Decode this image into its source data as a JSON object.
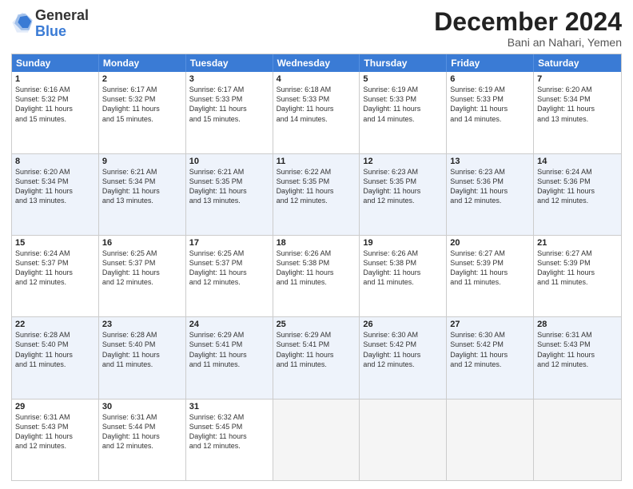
{
  "logo": {
    "general": "General",
    "blue": "Blue"
  },
  "title": "December 2024",
  "location": "Bani an Nahari, Yemen",
  "days": [
    "Sunday",
    "Monday",
    "Tuesday",
    "Wednesday",
    "Thursday",
    "Friday",
    "Saturday"
  ],
  "weeks": [
    [
      {
        "day": "1",
        "lines": [
          "Sunrise: 6:16 AM",
          "Sunset: 5:32 PM",
          "Daylight: 11 hours",
          "and 15 minutes."
        ]
      },
      {
        "day": "2",
        "lines": [
          "Sunrise: 6:17 AM",
          "Sunset: 5:32 PM",
          "Daylight: 11 hours",
          "and 15 minutes."
        ]
      },
      {
        "day": "3",
        "lines": [
          "Sunrise: 6:17 AM",
          "Sunset: 5:33 PM",
          "Daylight: 11 hours",
          "and 15 minutes."
        ]
      },
      {
        "day": "4",
        "lines": [
          "Sunrise: 6:18 AM",
          "Sunset: 5:33 PM",
          "Daylight: 11 hours",
          "and 14 minutes."
        ]
      },
      {
        "day": "5",
        "lines": [
          "Sunrise: 6:19 AM",
          "Sunset: 5:33 PM",
          "Daylight: 11 hours",
          "and 14 minutes."
        ]
      },
      {
        "day": "6",
        "lines": [
          "Sunrise: 6:19 AM",
          "Sunset: 5:33 PM",
          "Daylight: 11 hours",
          "and 14 minutes."
        ]
      },
      {
        "day": "7",
        "lines": [
          "Sunrise: 6:20 AM",
          "Sunset: 5:34 PM",
          "Daylight: 11 hours",
          "and 13 minutes."
        ]
      }
    ],
    [
      {
        "day": "8",
        "lines": [
          "Sunrise: 6:20 AM",
          "Sunset: 5:34 PM",
          "Daylight: 11 hours",
          "and 13 minutes."
        ]
      },
      {
        "day": "9",
        "lines": [
          "Sunrise: 6:21 AM",
          "Sunset: 5:34 PM",
          "Daylight: 11 hours",
          "and 13 minutes."
        ]
      },
      {
        "day": "10",
        "lines": [
          "Sunrise: 6:21 AM",
          "Sunset: 5:35 PM",
          "Daylight: 11 hours",
          "and 13 minutes."
        ]
      },
      {
        "day": "11",
        "lines": [
          "Sunrise: 6:22 AM",
          "Sunset: 5:35 PM",
          "Daylight: 11 hours",
          "and 12 minutes."
        ]
      },
      {
        "day": "12",
        "lines": [
          "Sunrise: 6:23 AM",
          "Sunset: 5:35 PM",
          "Daylight: 11 hours",
          "and 12 minutes."
        ]
      },
      {
        "day": "13",
        "lines": [
          "Sunrise: 6:23 AM",
          "Sunset: 5:36 PM",
          "Daylight: 11 hours",
          "and 12 minutes."
        ]
      },
      {
        "day": "14",
        "lines": [
          "Sunrise: 6:24 AM",
          "Sunset: 5:36 PM",
          "Daylight: 11 hours",
          "and 12 minutes."
        ]
      }
    ],
    [
      {
        "day": "15",
        "lines": [
          "Sunrise: 6:24 AM",
          "Sunset: 5:37 PM",
          "Daylight: 11 hours",
          "and 12 minutes."
        ]
      },
      {
        "day": "16",
        "lines": [
          "Sunrise: 6:25 AM",
          "Sunset: 5:37 PM",
          "Daylight: 11 hours",
          "and 12 minutes."
        ]
      },
      {
        "day": "17",
        "lines": [
          "Sunrise: 6:25 AM",
          "Sunset: 5:37 PM",
          "Daylight: 11 hours",
          "and 12 minutes."
        ]
      },
      {
        "day": "18",
        "lines": [
          "Sunrise: 6:26 AM",
          "Sunset: 5:38 PM",
          "Daylight: 11 hours",
          "and 11 minutes."
        ]
      },
      {
        "day": "19",
        "lines": [
          "Sunrise: 6:26 AM",
          "Sunset: 5:38 PM",
          "Daylight: 11 hours",
          "and 11 minutes."
        ]
      },
      {
        "day": "20",
        "lines": [
          "Sunrise: 6:27 AM",
          "Sunset: 5:39 PM",
          "Daylight: 11 hours",
          "and 11 minutes."
        ]
      },
      {
        "day": "21",
        "lines": [
          "Sunrise: 6:27 AM",
          "Sunset: 5:39 PM",
          "Daylight: 11 hours",
          "and 11 minutes."
        ]
      }
    ],
    [
      {
        "day": "22",
        "lines": [
          "Sunrise: 6:28 AM",
          "Sunset: 5:40 PM",
          "Daylight: 11 hours",
          "and 11 minutes."
        ]
      },
      {
        "day": "23",
        "lines": [
          "Sunrise: 6:28 AM",
          "Sunset: 5:40 PM",
          "Daylight: 11 hours",
          "and 11 minutes."
        ]
      },
      {
        "day": "24",
        "lines": [
          "Sunrise: 6:29 AM",
          "Sunset: 5:41 PM",
          "Daylight: 11 hours",
          "and 11 minutes."
        ]
      },
      {
        "day": "25",
        "lines": [
          "Sunrise: 6:29 AM",
          "Sunset: 5:41 PM",
          "Daylight: 11 hours",
          "and 11 minutes."
        ]
      },
      {
        "day": "26",
        "lines": [
          "Sunrise: 6:30 AM",
          "Sunset: 5:42 PM",
          "Daylight: 11 hours",
          "and 12 minutes."
        ]
      },
      {
        "day": "27",
        "lines": [
          "Sunrise: 6:30 AM",
          "Sunset: 5:42 PM",
          "Daylight: 11 hours",
          "and 12 minutes."
        ]
      },
      {
        "day": "28",
        "lines": [
          "Sunrise: 6:31 AM",
          "Sunset: 5:43 PM",
          "Daylight: 11 hours",
          "and 12 minutes."
        ]
      }
    ],
    [
      {
        "day": "29",
        "lines": [
          "Sunrise: 6:31 AM",
          "Sunset: 5:43 PM",
          "Daylight: 11 hours",
          "and 12 minutes."
        ]
      },
      {
        "day": "30",
        "lines": [
          "Sunrise: 6:31 AM",
          "Sunset: 5:44 PM",
          "Daylight: 11 hours",
          "and 12 minutes."
        ]
      },
      {
        "day": "31",
        "lines": [
          "Sunrise: 6:32 AM",
          "Sunset: 5:45 PM",
          "Daylight: 11 hours",
          "and 12 minutes."
        ]
      },
      null,
      null,
      null,
      null
    ]
  ]
}
